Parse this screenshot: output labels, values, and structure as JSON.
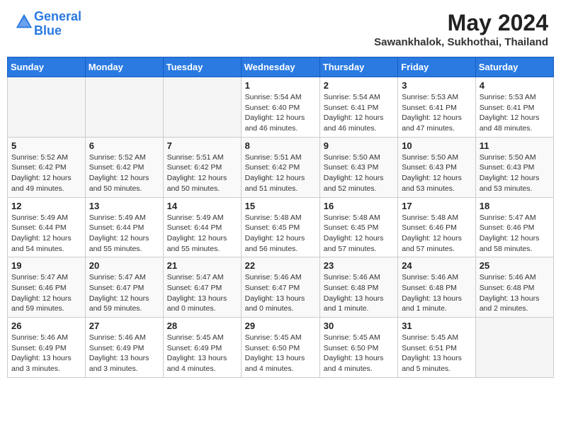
{
  "header": {
    "logo_line1": "General",
    "logo_line2": "Blue",
    "month_year": "May 2024",
    "location": "Sawankhalok, Sukhothai, Thailand"
  },
  "days_of_week": [
    "Sunday",
    "Monday",
    "Tuesday",
    "Wednesday",
    "Thursday",
    "Friday",
    "Saturday"
  ],
  "weeks": [
    [
      {
        "day": "",
        "info": ""
      },
      {
        "day": "",
        "info": ""
      },
      {
        "day": "",
        "info": ""
      },
      {
        "day": "1",
        "info": "Sunrise: 5:54 AM\nSunset: 6:40 PM\nDaylight: 12 hours\nand 46 minutes."
      },
      {
        "day": "2",
        "info": "Sunrise: 5:54 AM\nSunset: 6:41 PM\nDaylight: 12 hours\nand 46 minutes."
      },
      {
        "day": "3",
        "info": "Sunrise: 5:53 AM\nSunset: 6:41 PM\nDaylight: 12 hours\nand 47 minutes."
      },
      {
        "day": "4",
        "info": "Sunrise: 5:53 AM\nSunset: 6:41 PM\nDaylight: 12 hours\nand 48 minutes."
      }
    ],
    [
      {
        "day": "5",
        "info": "Sunrise: 5:52 AM\nSunset: 6:42 PM\nDaylight: 12 hours\nand 49 minutes."
      },
      {
        "day": "6",
        "info": "Sunrise: 5:52 AM\nSunset: 6:42 PM\nDaylight: 12 hours\nand 50 minutes."
      },
      {
        "day": "7",
        "info": "Sunrise: 5:51 AM\nSunset: 6:42 PM\nDaylight: 12 hours\nand 50 minutes."
      },
      {
        "day": "8",
        "info": "Sunrise: 5:51 AM\nSunset: 6:42 PM\nDaylight: 12 hours\nand 51 minutes."
      },
      {
        "day": "9",
        "info": "Sunrise: 5:50 AM\nSunset: 6:43 PM\nDaylight: 12 hours\nand 52 minutes."
      },
      {
        "day": "10",
        "info": "Sunrise: 5:50 AM\nSunset: 6:43 PM\nDaylight: 12 hours\nand 53 minutes."
      },
      {
        "day": "11",
        "info": "Sunrise: 5:50 AM\nSunset: 6:43 PM\nDaylight: 12 hours\nand 53 minutes."
      }
    ],
    [
      {
        "day": "12",
        "info": "Sunrise: 5:49 AM\nSunset: 6:44 PM\nDaylight: 12 hours\nand 54 minutes."
      },
      {
        "day": "13",
        "info": "Sunrise: 5:49 AM\nSunset: 6:44 PM\nDaylight: 12 hours\nand 55 minutes."
      },
      {
        "day": "14",
        "info": "Sunrise: 5:49 AM\nSunset: 6:44 PM\nDaylight: 12 hours\nand 55 minutes."
      },
      {
        "day": "15",
        "info": "Sunrise: 5:48 AM\nSunset: 6:45 PM\nDaylight: 12 hours\nand 56 minutes."
      },
      {
        "day": "16",
        "info": "Sunrise: 5:48 AM\nSunset: 6:45 PM\nDaylight: 12 hours\nand 57 minutes."
      },
      {
        "day": "17",
        "info": "Sunrise: 5:48 AM\nSunset: 6:46 PM\nDaylight: 12 hours\nand 57 minutes."
      },
      {
        "day": "18",
        "info": "Sunrise: 5:47 AM\nSunset: 6:46 PM\nDaylight: 12 hours\nand 58 minutes."
      }
    ],
    [
      {
        "day": "19",
        "info": "Sunrise: 5:47 AM\nSunset: 6:46 PM\nDaylight: 12 hours\nand 59 minutes."
      },
      {
        "day": "20",
        "info": "Sunrise: 5:47 AM\nSunset: 6:47 PM\nDaylight: 12 hours\nand 59 minutes."
      },
      {
        "day": "21",
        "info": "Sunrise: 5:47 AM\nSunset: 6:47 PM\nDaylight: 13 hours\nand 0 minutes."
      },
      {
        "day": "22",
        "info": "Sunrise: 5:46 AM\nSunset: 6:47 PM\nDaylight: 13 hours\nand 0 minutes."
      },
      {
        "day": "23",
        "info": "Sunrise: 5:46 AM\nSunset: 6:48 PM\nDaylight: 13 hours\nand 1 minute."
      },
      {
        "day": "24",
        "info": "Sunrise: 5:46 AM\nSunset: 6:48 PM\nDaylight: 13 hours\nand 1 minute."
      },
      {
        "day": "25",
        "info": "Sunrise: 5:46 AM\nSunset: 6:48 PM\nDaylight: 13 hours\nand 2 minutes."
      }
    ],
    [
      {
        "day": "26",
        "info": "Sunrise: 5:46 AM\nSunset: 6:49 PM\nDaylight: 13 hours\nand 3 minutes."
      },
      {
        "day": "27",
        "info": "Sunrise: 5:46 AM\nSunset: 6:49 PM\nDaylight: 13 hours\nand 3 minutes."
      },
      {
        "day": "28",
        "info": "Sunrise: 5:45 AM\nSunset: 6:49 PM\nDaylight: 13 hours\nand 4 minutes."
      },
      {
        "day": "29",
        "info": "Sunrise: 5:45 AM\nSunset: 6:50 PM\nDaylight: 13 hours\nand 4 minutes."
      },
      {
        "day": "30",
        "info": "Sunrise: 5:45 AM\nSunset: 6:50 PM\nDaylight: 13 hours\nand 4 minutes."
      },
      {
        "day": "31",
        "info": "Sunrise: 5:45 AM\nSunset: 6:51 PM\nDaylight: 13 hours\nand 5 minutes."
      },
      {
        "day": "",
        "info": ""
      }
    ]
  ]
}
